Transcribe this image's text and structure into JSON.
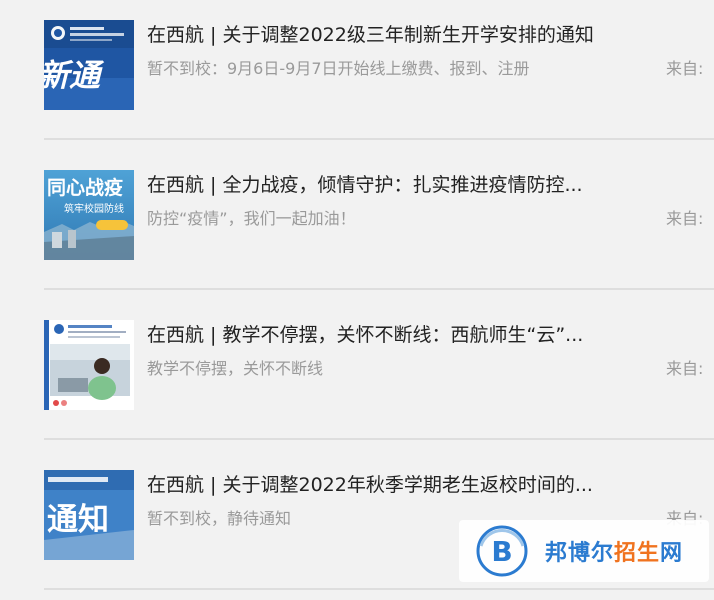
{
  "articles": [
    {
      "title": "在西航 | 关于调整2022级三年制新生开学安排的通知",
      "summary": "暂不到校：9月6日-9月7日开始线上缴费、报到、注册",
      "source_label": "来自:",
      "thumbnail": {
        "kind": "notice-banner",
        "text": "新通",
        "bg": "#1f56a3"
      }
    },
    {
      "title": "在西航 | 全力战疫，倾情守护：扎实推进疫情防控...",
      "summary": "防控“疫情”，我们一起加油！",
      "source_label": "来自:",
      "thumbnail": {
        "kind": "poster",
        "text": "同心战疫",
        "subtext": "筑牢校园防线",
        "bg": "#3f93c9"
      }
    },
    {
      "title": "在西航 | 教学不停摆，关怀不断线：西航师生“云”...",
      "summary": "教学不停摆，关怀不断线",
      "source_label": "来自:",
      "thumbnail": {
        "kind": "photo",
        "bg": "#ffffff"
      }
    },
    {
      "title": "在西航 | 关于调整2022年秋季学期老生返校时间的...",
      "summary": "暂不到校，静待通知",
      "source_label": "来自:",
      "thumbnail": {
        "kind": "notice-banner",
        "text": "通知",
        "bg": "#2f6cb2"
      }
    }
  ],
  "watermark": {
    "brand_main": "邦博尔",
    "brand_accent": "招生",
    "brand_tail": "网",
    "logo_letter": "B",
    "colors": {
      "primary": "#2b7bd0",
      "accent": "#f0731f"
    }
  },
  "colors": {
    "page_bg": "#f2f2f2",
    "title": "#222222",
    "muted": "#9a9a9a",
    "divider": "#dedede"
  }
}
